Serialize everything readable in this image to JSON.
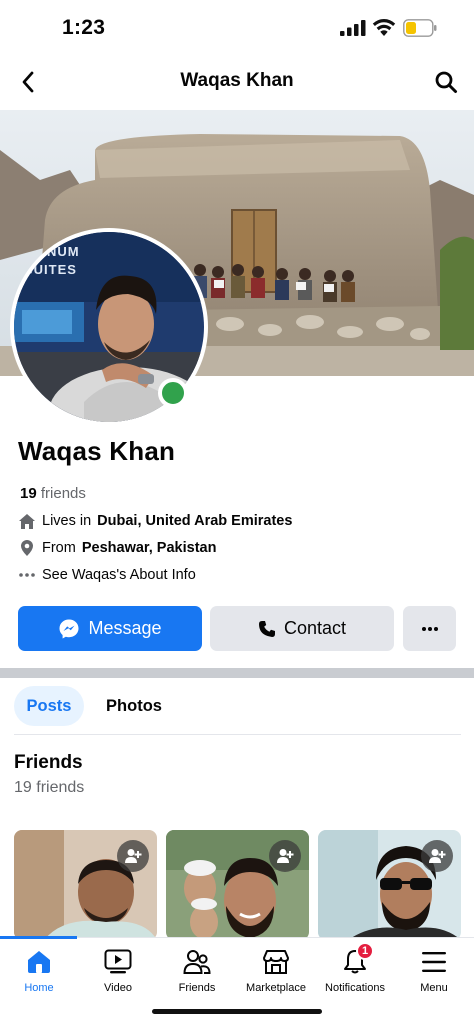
{
  "status_bar": {
    "time": "1:23"
  },
  "header": {
    "title": "Waqas Khan"
  },
  "profile": {
    "name": "Waqas Khan",
    "friends_count": "19",
    "friends_label": "friends",
    "lives_prefix": "Lives in",
    "lives_value": "Dubai, United Arab Emirates",
    "from_prefix": "From",
    "from_value": "Peshawar, Pakistan",
    "about_text": "See Waqas's About Info"
  },
  "actions": {
    "message_label": "Message",
    "contact_label": "Contact"
  },
  "tabs": [
    {
      "label": "Posts",
      "active": true
    },
    {
      "label": "Photos",
      "active": false
    }
  ],
  "friends_section": {
    "title": "Friends",
    "count_text": "19 friends"
  },
  "bottom_nav": [
    {
      "label": "Home",
      "icon": "home-icon",
      "active": true
    },
    {
      "label": "Video",
      "icon": "video-icon",
      "active": false
    },
    {
      "label": "Friends",
      "icon": "friends-icon",
      "active": false
    },
    {
      "label": "Marketplace",
      "icon": "marketplace-icon",
      "active": false
    },
    {
      "label": "Notifications",
      "icon": "bell-icon",
      "active": false,
      "badge": "1"
    },
    {
      "label": "Menu",
      "icon": "menu-icon",
      "active": false
    }
  ],
  "colors": {
    "accent": "#1877f2",
    "online": "#31a24c",
    "badge": "#e41e3f",
    "secondary_button": "#e4e6eb"
  }
}
